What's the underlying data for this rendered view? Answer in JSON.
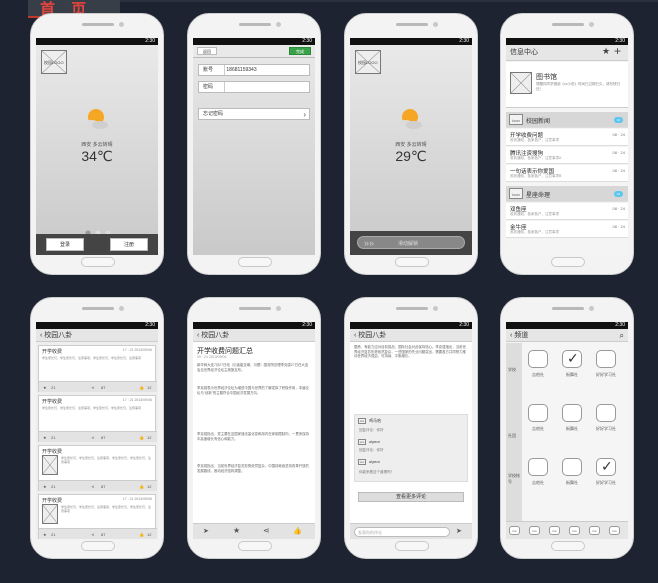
{
  "page": {
    "title_tab": "首 页"
  },
  "status": {
    "time": "2:30"
  },
  "weather1": {
    "logo": "校园LOGO",
    "city": "西安  多云转晴",
    "temp": "34℃",
    "login": "登录",
    "register": "注册"
  },
  "login": {
    "back": "返回",
    "done": "完成",
    "account_label": "账号",
    "account_value": "18681159343",
    "password_label": "密码",
    "forgot": "忘记密码"
  },
  "weather2": {
    "logo": "校园LOGO",
    "city": "西安  多云转晴",
    "temp": "29℃",
    "unlock": "滑动解锁"
  },
  "messages": {
    "title": "信息中心",
    "library": {
      "icon": "icon",
      "name": "图书馆",
      "desc": "提醒你同学借阅《xx小说》时间已过期已久，请尽快归还！"
    },
    "items": [
      {
        "title": "校园新闻",
        "sub": "",
        "date": "",
        "icon": "icon",
        "bubble": "10",
        "highlight": true
      },
      {
        "title": "开学收费问题",
        "sub": "收到通知，各家各户，注意事项",
        "date": "08 · 24",
        "highlight": false
      },
      {
        "title": "腾讯注资搜狗",
        "sub": "收到通知，各家各户，注意事项A",
        "date": "08 · 24",
        "highlight": false
      },
      {
        "title": "一句话表示你爱国",
        "sub": "收到通知，各家各户，注意事项B",
        "date": "08 · 24",
        "highlight": false
      },
      {
        "title": "星座命理",
        "sub": "",
        "date": "",
        "icon": "icon",
        "bubble": "10",
        "highlight": true
      },
      {
        "title": "双鱼座",
        "sub": "收到通知，各家各户，注意事项",
        "date": "08 · 24",
        "highlight": false
      },
      {
        "title": "金牛座",
        "sub": "收到通知，各家各户，注意事项",
        "date": "08 · 24",
        "highlight": false
      }
    ]
  },
  "gossip": {
    "title": "校园八卦",
    "cards": [
      {
        "title": "开学收费",
        "date": "17 : 21 2013/09/06",
        "body": "学生家长们，学生家长们，注意事项，学生家长们，学生家长们，注意事项",
        "stars": "21",
        "shares": "87",
        "likes": "12"
      },
      {
        "title": "开学收费",
        "date": "17 : 21 2013/09/06",
        "body": "学生家长们，学生家长们，注意事项，学生家长们，学生家长们，注意事项",
        "stars": "21",
        "shares": "87",
        "likes": "12"
      },
      {
        "title": "开学收费",
        "date": "17 : 21 2013/09/06",
        "body": "学生家长们，学生家长们，注意事项，学生家长们，学生家长们，注意事项",
        "stars": "21",
        "shares": "87",
        "likes": "12"
      },
      {
        "title": "开学收费",
        "date": "17 : 21 2013/09/06",
        "body": "学生家长们，学生家长们，注意事项，学生家长们，学生家长们，注意事项",
        "stars": "21",
        "shares": "87",
        "likes": "12"
      }
    ]
  },
  "article": {
    "title": "校园八卦",
    "headline": "开学收费问题汇总",
    "meta": "09 · 24  2013/09/06",
    "paras": [
      "新华网大连7月27日电（记者崔至琳、冯蕾）国务院总理李克强27日在大连会见世界经济论坛主席施瓦布。",
      "李克强表示世界经济论坛为增进中国与世界的了解发挥了积极作用，本届论坛与“创新”的主题符合中国经济发展方向。",
      "李克强指出，党主要在这国家速法量化变和用内在家制限制内，一贯来保持中高速增长有信心和能力。",
      "李克强指出，当前世界经济复苏形势依然复杂，中国将继续坚持改革开放的发展路线，推动经济结构调整。"
    ]
  },
  "comments": {
    "text": "据悉，有能力应对目前挑战，国际社会对此保持信心。李克强指出，当前世界经济复苏形势依然复杂，一些国家的失业问题突出，需要各方共同努力推动世界经济强劲、可持续、平衡增长。",
    "name1": "鸡马哈",
    "reply1": "回复评论：你好",
    "name2": "ulyeor",
    "reply2": "回复评论：你好",
    "name3": "ulyeor",
    "reply3": "你能来看这个道理吗？",
    "more": "查看更多评论",
    "input": "发表你的评论"
  },
  "channels": {
    "title": "频道",
    "side": [
      "学校",
      "社团",
      "学校帐号"
    ],
    "tiles": [
      {
        "label": "吉他社",
        "checked": false
      },
      {
        "label": "街舞社",
        "checked": true
      },
      {
        "label": "好好学习社",
        "checked": false
      },
      {
        "label": "吉他社",
        "checked": false
      },
      {
        "label": "街舞社",
        "checked": false
      },
      {
        "label": "好好学习社",
        "checked": false
      },
      {
        "label": "吉他社",
        "checked": false
      },
      {
        "label": "街舞社",
        "checked": false
      },
      {
        "label": "好好学习社",
        "checked": true
      }
    ],
    "tabs": [
      "icon",
      "icon",
      "icon",
      "icon",
      "icon",
      "icon"
    ]
  }
}
